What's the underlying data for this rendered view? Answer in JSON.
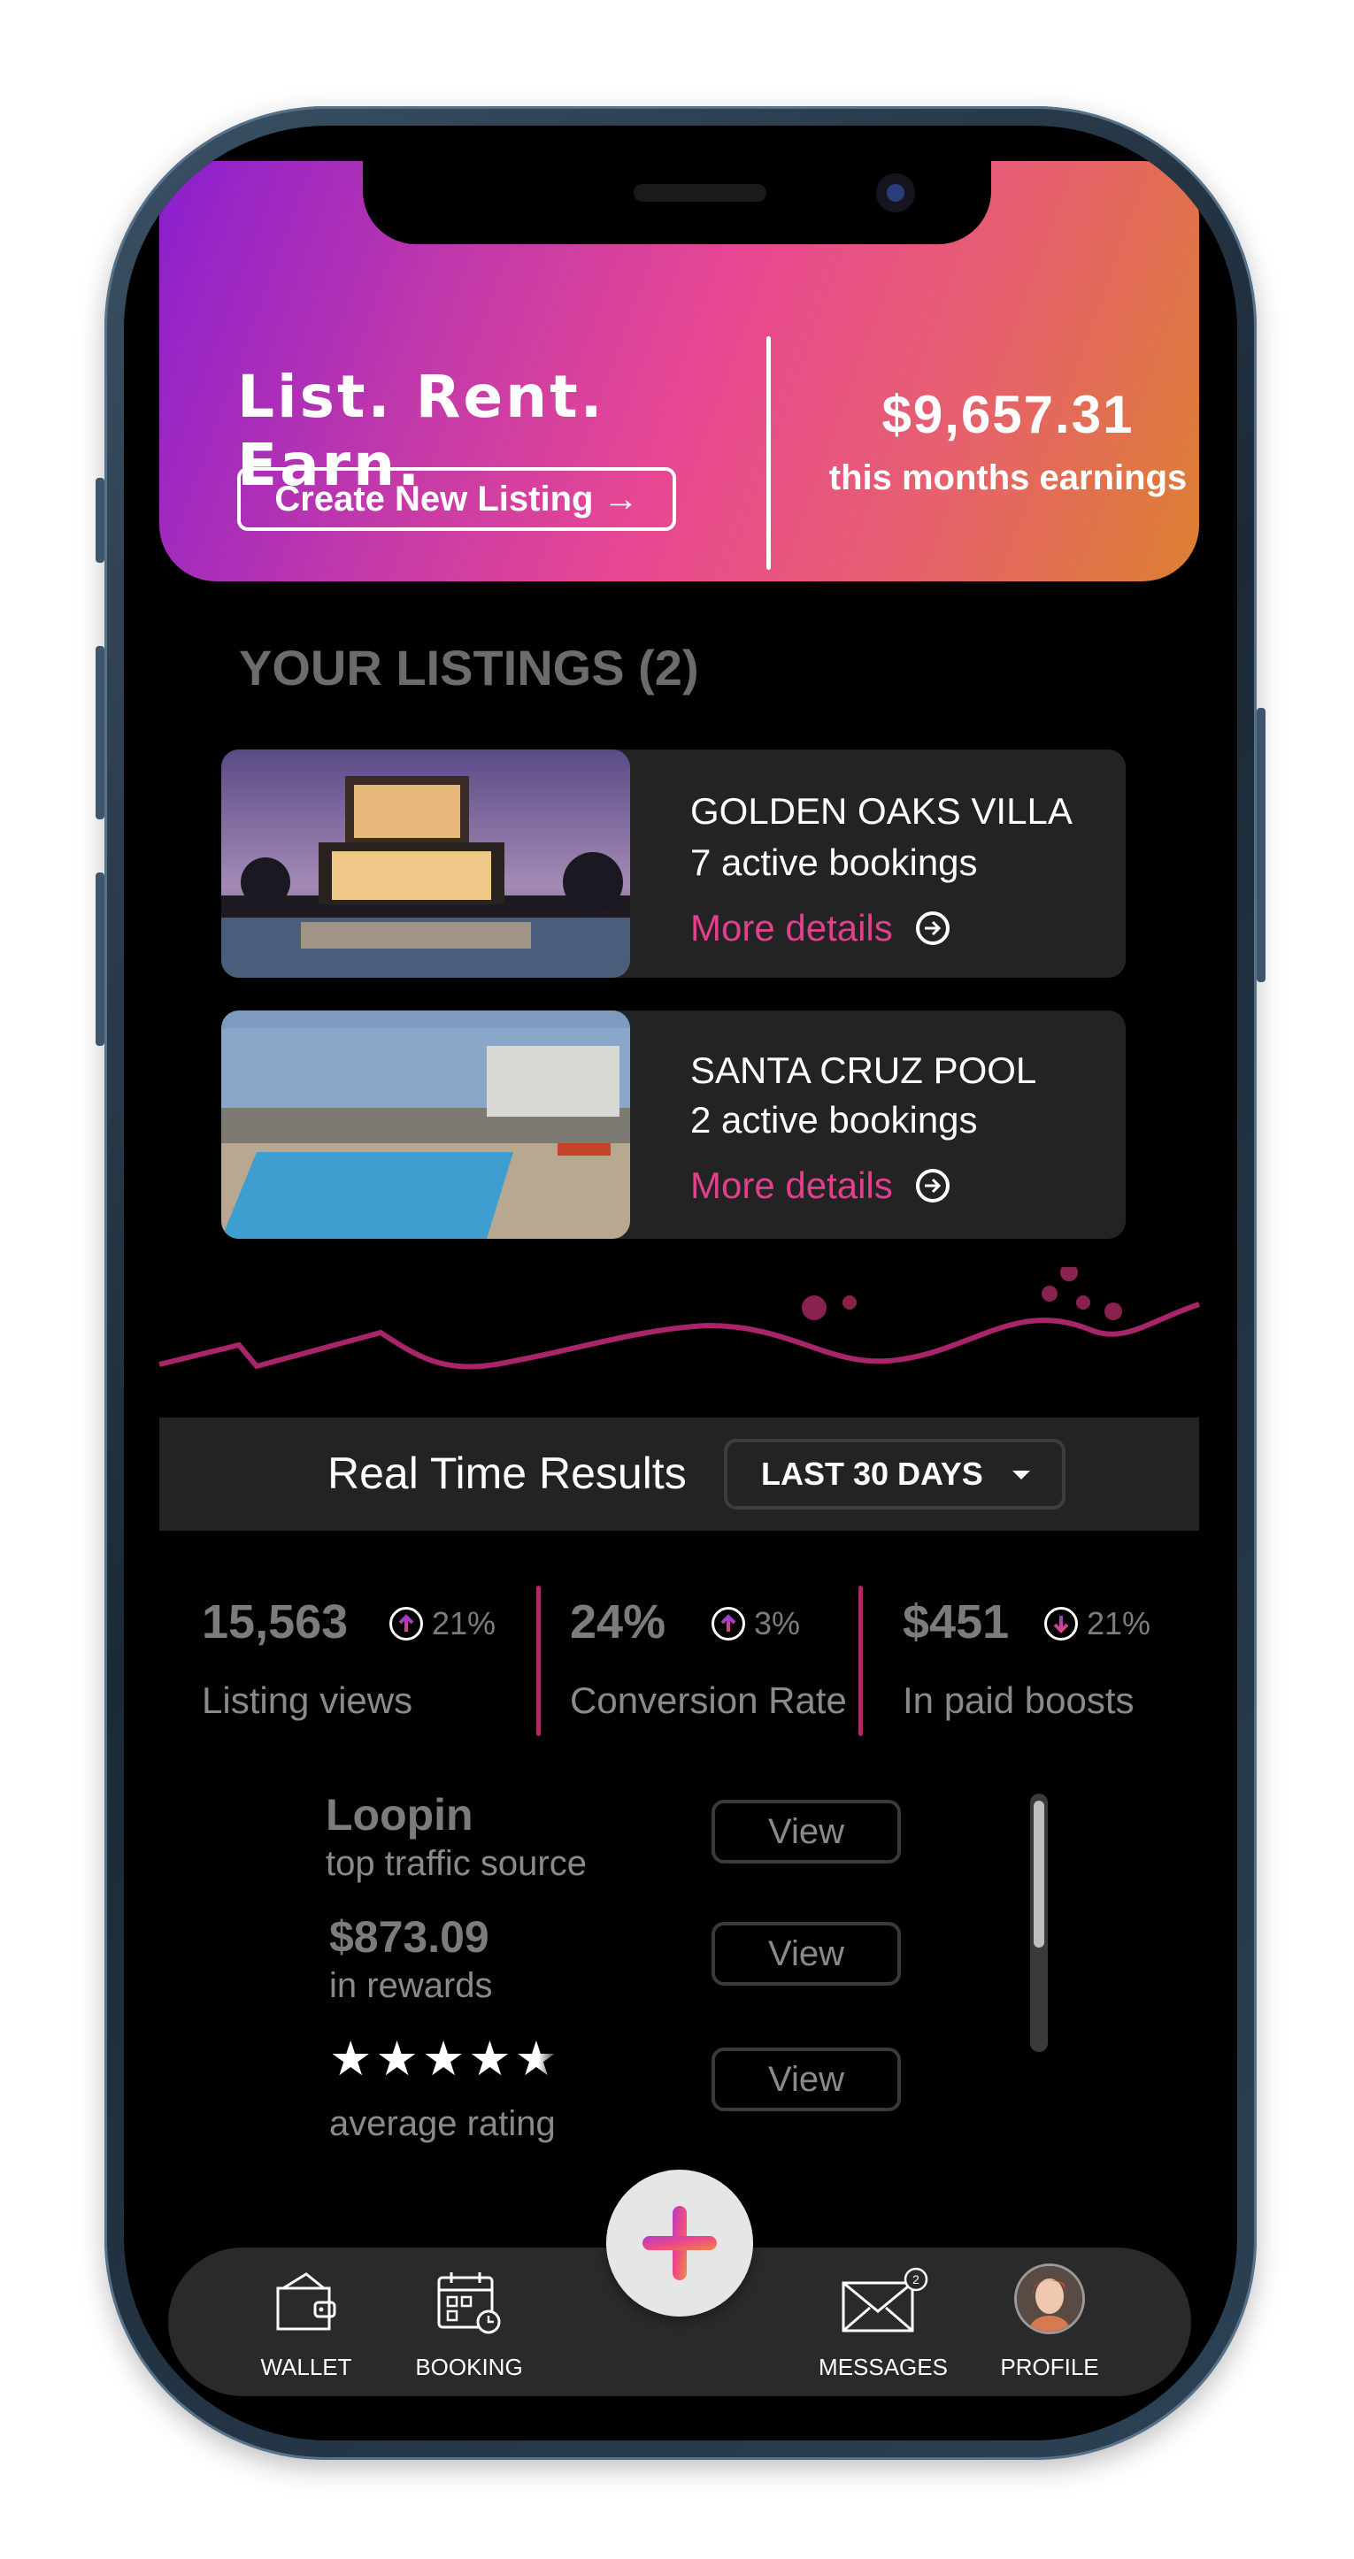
{
  "banner": {
    "tagline": "List. Rent. Earn.",
    "create_button": "Create New Listing →",
    "earnings_amount": "$9,657.31",
    "earnings_label": "this months earnings"
  },
  "listings": {
    "title": "YOUR LISTINGS (2)",
    "items": [
      {
        "name": "GOLDEN OAKS VILLA",
        "bookings": "7 active bookings",
        "link": "More details"
      },
      {
        "name": "SANTA CRUZ POOL",
        "bookings": "2 active bookings",
        "link": "More details"
      }
    ]
  },
  "results": {
    "title": "Real Time Results",
    "range": "LAST 30 DAYS",
    "stats": [
      {
        "value": "15,563",
        "change": "21%",
        "direction": "up",
        "label": "Listing views"
      },
      {
        "value": "24%",
        "change": "3%",
        "direction": "up",
        "label": "Conversion Rate"
      },
      {
        "value": "$451",
        "change": "21%",
        "direction": "down",
        "label": "In paid boosts"
      }
    ]
  },
  "details": {
    "traffic_source": "Loopin",
    "traffic_label": "top traffic source",
    "rewards_value": "$873.09",
    "rewards_label": "in rewards",
    "rating_value": 4.5,
    "rating_label": "average rating",
    "view_label": "View"
  },
  "nav": {
    "wallet": "WALLET",
    "booking": "BOOKING",
    "messages": "MESSAGES",
    "messages_badge": "2",
    "profile": "PROFILE"
  },
  "colors": {
    "accent": "#e0408e",
    "divider": "#b02a66",
    "banner_start": "#8a1fcf",
    "banner_end": "#dc8030"
  }
}
